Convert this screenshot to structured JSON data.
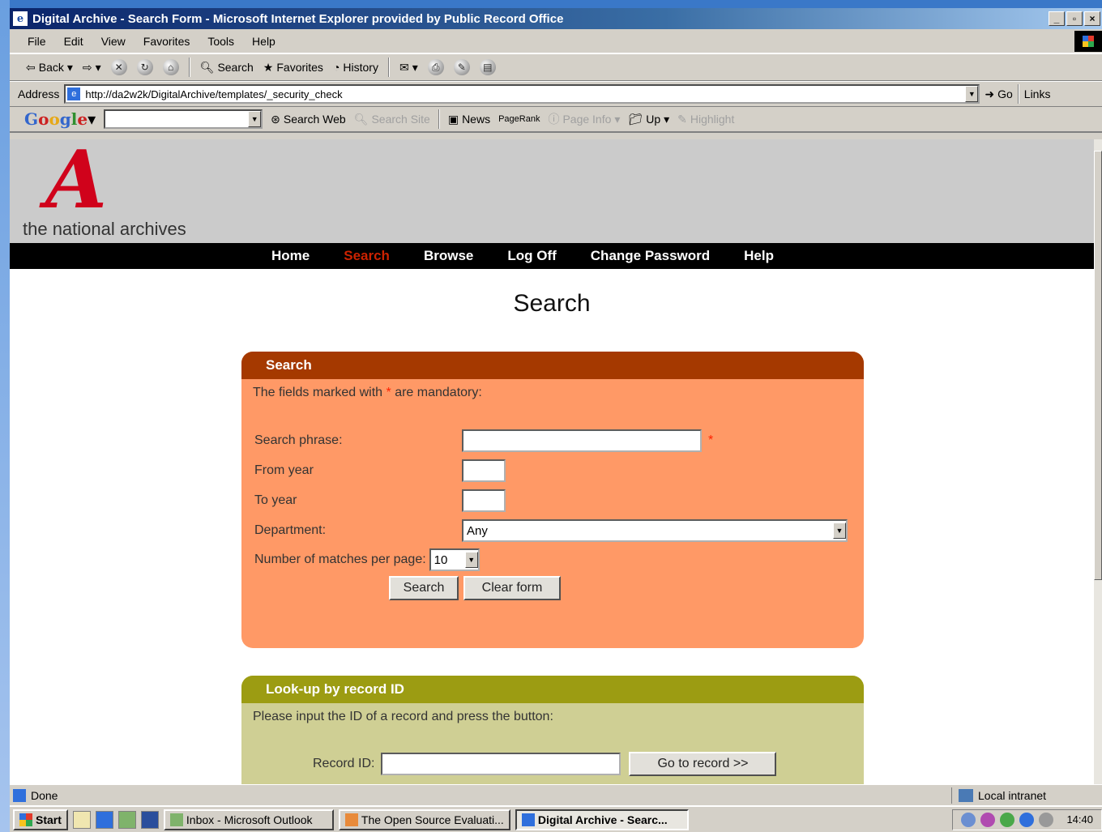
{
  "window": {
    "title": "Digital Archive - Search Form - Microsoft Internet Explorer provided by Public Record Office"
  },
  "menu": [
    "File",
    "Edit",
    "View",
    "Favorites",
    "Tools",
    "Help"
  ],
  "toolbar": {
    "back": "Back",
    "search": "Search",
    "favorites": "Favorites",
    "history": "History"
  },
  "address": {
    "label": "Address",
    "url": "http://da2w2k/DigitalArchive/templates/_security_check",
    "go": "Go",
    "links": "Links"
  },
  "google": {
    "search_web": "Search Web",
    "search_site": "Search Site",
    "news": "News",
    "pagerank": "PageRank",
    "page_info": "Page Info",
    "up": "Up",
    "highlight": "Highlight"
  },
  "site": {
    "logo_letter": "A",
    "logo_text": "the national archives",
    "nav": [
      "Home",
      "Search",
      "Browse",
      "Log Off",
      "Change Password",
      "Help"
    ],
    "page_title": "Search"
  },
  "search_panel": {
    "heading": "Search",
    "intro_before": "The fields marked with ",
    "intro_star": "*",
    "intro_after": " are mandatory:",
    "search_phrase_label": "Search phrase:",
    "search_phrase_value": "",
    "required_marker": "*",
    "from_year_label": "From year",
    "from_year_value": "",
    "to_year_label": "To year",
    "to_year_value": "",
    "department_label": "Department:",
    "department_value": "Any",
    "matches_label": "Number of matches per page:",
    "matches_value": "10",
    "search_button": "Search",
    "clear_button": "Clear form"
  },
  "lookup_panel": {
    "heading": "Look-up by record ID",
    "intro": "Please input the ID of a record and press the button:",
    "record_label": "Record ID:",
    "record_value": "",
    "go_button": "Go to record >>"
  },
  "status": {
    "text": "Done",
    "zone": "Local intranet"
  },
  "taskbar": {
    "start": "Start",
    "tasks": [
      "Inbox - Microsoft Outlook",
      "The Open Source Evaluati...",
      "Digital Archive - Searc..."
    ],
    "clock": "14:40"
  }
}
